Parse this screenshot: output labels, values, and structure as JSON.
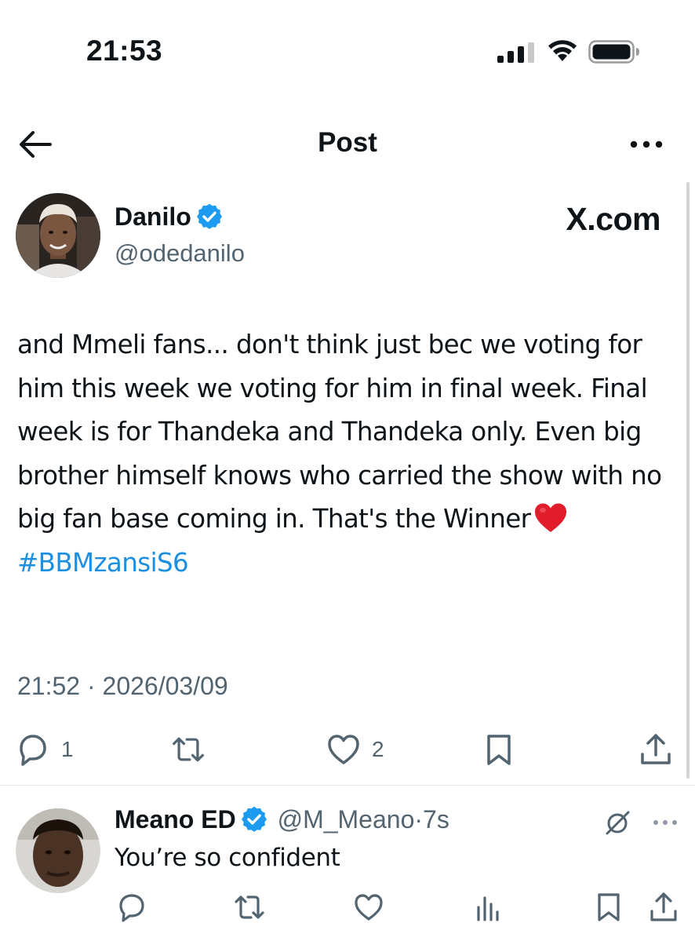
{
  "status_bar": {
    "time": "21:53",
    "signal_icon": "cellular-signal-icon",
    "wifi_icon": "wifi-icon",
    "battery_icon": "battery-icon"
  },
  "header": {
    "title": "Post",
    "back_icon": "arrow-left-icon",
    "more_icon": "more-horizontal-icon"
  },
  "post": {
    "author": {
      "name": "Danilo",
      "handle": "@odedanilo",
      "verified": true
    },
    "brand_mark": "X.com",
    "text": "and Mmeli fans... don't think just bec we voting for him this week we voting for him in final week. Final week is for Thandeka and Thandeka only. Even big brother himself knows who carried the show with no big fan base coming in. That's the Winner",
    "hashtag": "#BBMzansiS6",
    "timestamp": "21:52 · 2026/03/09",
    "actions": {
      "replies": "1",
      "reposts": "",
      "likes": "2"
    }
  },
  "reply": {
    "author": {
      "name": "Meano ED",
      "handle": "@M_Meano",
      "verified": true
    },
    "separator": "·",
    "time": "7s",
    "text": "You’re so confident"
  },
  "colors": {
    "accent": "#1d9bf0",
    "text": "#0f1419",
    "muted": "#536471",
    "heart": "#e11d2b"
  }
}
